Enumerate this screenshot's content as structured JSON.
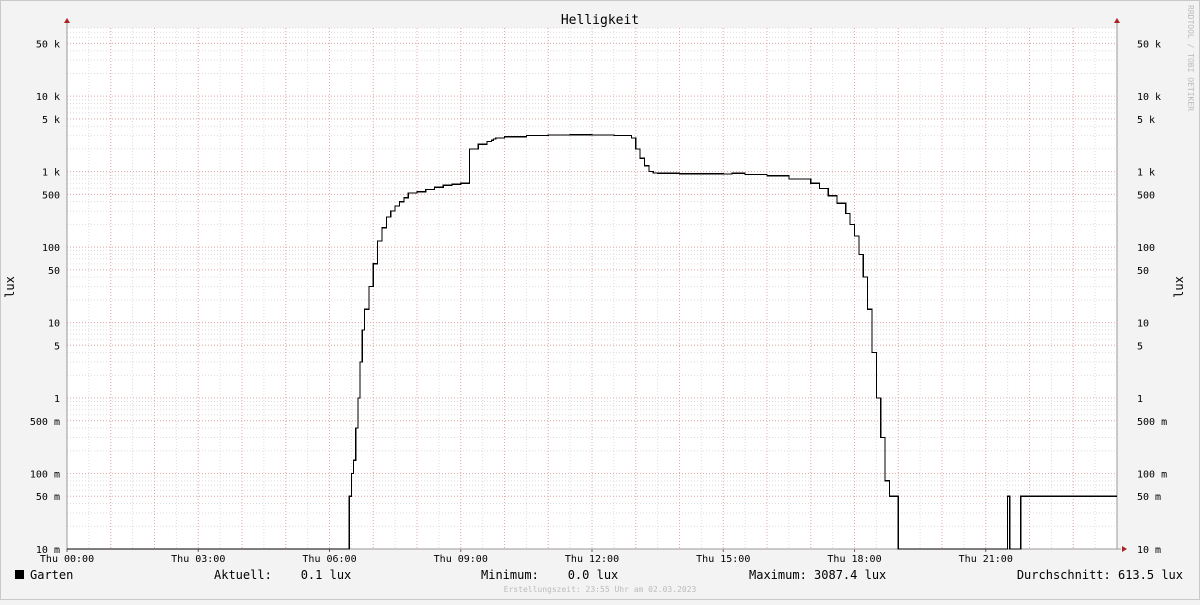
{
  "chart_data": {
    "type": "line",
    "title": "Helligkeit",
    "ylabel": "lux",
    "y_scale": "log",
    "ylim": [
      0.01,
      80000
    ],
    "xlim_hours": [
      0,
      24
    ],
    "y_ticks": [
      {
        "value": 50000,
        "label": "50 k"
      },
      {
        "value": 10000,
        "label": "10 k"
      },
      {
        "value": 5000,
        "label": "5 k"
      },
      {
        "value": 1000,
        "label": "1 k"
      },
      {
        "value": 500,
        "label": "500"
      },
      {
        "value": 100,
        "label": "100"
      },
      {
        "value": 50,
        "label": "50"
      },
      {
        "value": 10,
        "label": "10"
      },
      {
        "value": 5,
        "label": "5"
      },
      {
        "value": 1,
        "label": "1"
      },
      {
        "value": 0.5,
        "label": "500 m"
      },
      {
        "value": 0.1,
        "label": "100 m"
      },
      {
        "value": 0.05,
        "label": "50 m"
      },
      {
        "value": 0.01,
        "label": "10 m"
      }
    ],
    "x_ticks": [
      {
        "value": 0,
        "label": "Thu 00:00"
      },
      {
        "value": 3,
        "label": "Thu 03:00"
      },
      {
        "value": 6,
        "label": "Thu 06:00"
      },
      {
        "value": 9,
        "label": "Thu 09:00"
      },
      {
        "value": 12,
        "label": "Thu 12:00"
      },
      {
        "value": 15,
        "label": "Thu 15:00"
      },
      {
        "value": 18,
        "label": "Thu 18:00"
      },
      {
        "value": 21,
        "label": "Thu 21:00"
      }
    ],
    "grid": true,
    "series": [
      {
        "name": "Garten",
        "color": "#000000",
        "x": [
          0,
          6.4,
          6.45,
          6.5,
          6.55,
          6.6,
          6.65,
          6.7,
          6.75,
          6.8,
          6.9,
          7.0,
          7.1,
          7.2,
          7.3,
          7.4,
          7.5,
          7.6,
          7.7,
          7.8,
          7.9,
          8.0,
          8.2,
          8.4,
          8.6,
          8.8,
          9.0,
          9.2,
          9.4,
          9.6,
          9.7,
          9.75,
          9.8,
          10.0,
          10.5,
          11.0,
          11.5,
          12.0,
          12.5,
          12.9,
          13.0,
          13.1,
          13.2,
          13.3,
          13.4,
          13.5,
          14.0,
          15.0,
          15.2,
          15.5,
          16.0,
          16.5,
          17.0,
          17.2,
          17.4,
          17.6,
          17.8,
          17.9,
          18.0,
          18.1,
          18.2,
          18.3,
          18.4,
          18.5,
          18.6,
          18.7,
          18.8,
          18.9,
          19.0,
          19.05,
          19.1,
          21.45,
          21.5,
          21.55,
          21.75,
          21.8,
          24
        ],
        "y": [
          0.01,
          0.01,
          0.05,
          0.1,
          0.15,
          0.4,
          1,
          3,
          8,
          15,
          30,
          60,
          120,
          180,
          250,
          300,
          350,
          400,
          450,
          520,
          520,
          540,
          580,
          620,
          660,
          680,
          700,
          2000,
          2300,
          2500,
          2600,
          2700,
          2800,
          2900,
          3000,
          3050,
          3087,
          3050,
          3000,
          2800,
          2000,
          1500,
          1200,
          1000,
          960,
          950,
          940,
          930,
          950,
          920,
          880,
          800,
          700,
          600,
          480,
          380,
          280,
          200,
          140,
          80,
          40,
          15,
          4,
          1,
          0.3,
          0.08,
          0.05,
          0.05,
          0.01,
          0.01,
          0.01,
          0.01,
          0.05,
          0.01,
          0.01,
          0.05,
          0.05
        ]
      }
    ],
    "legend": [
      {
        "name": "Garten",
        "color": "#000000"
      }
    ]
  },
  "stats": {
    "aktuell": "Aktuell:    0.1 lux",
    "minimum": "Minimum:    0.0 lux",
    "maximum": "Maximum: 3087.4 lux",
    "durchschnitt": "Durchschnitt: 613.5 lux"
  },
  "watermark": "RRDTOOL / TOBI OETIKER",
  "footer": "Erstellungszeit: 23:55 Uhr am 02.03.2023",
  "colors": {
    "minor_grid": "#dddddd",
    "major_grid": "#e7a9a9",
    "axis": "#999999",
    "arrow": "#aa2222"
  }
}
